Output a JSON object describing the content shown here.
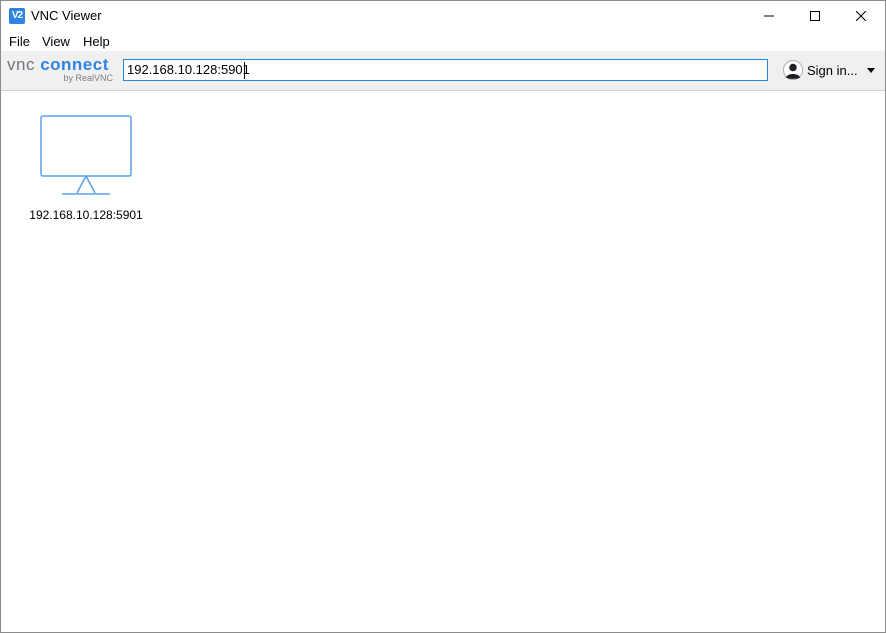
{
  "window": {
    "title": "VNC Viewer",
    "app_icon_text": "V2"
  },
  "menu": {
    "items": [
      "File",
      "View",
      "Help"
    ]
  },
  "toolbar": {
    "logo_vnc": "vnc",
    "logo_connect": "connect",
    "logo_sub": "by RealVNC",
    "address_value": "192.168.10.128:5901",
    "sign_in_label": "Sign in..."
  },
  "connections": [
    {
      "label": "192.168.10.128:5901",
      "icon": "monitor-icon"
    }
  ],
  "colors": {
    "accent": "#2f84e0",
    "toolbar_bg": "#f0f0f0",
    "monitor_stroke": "#5aa0e6"
  }
}
